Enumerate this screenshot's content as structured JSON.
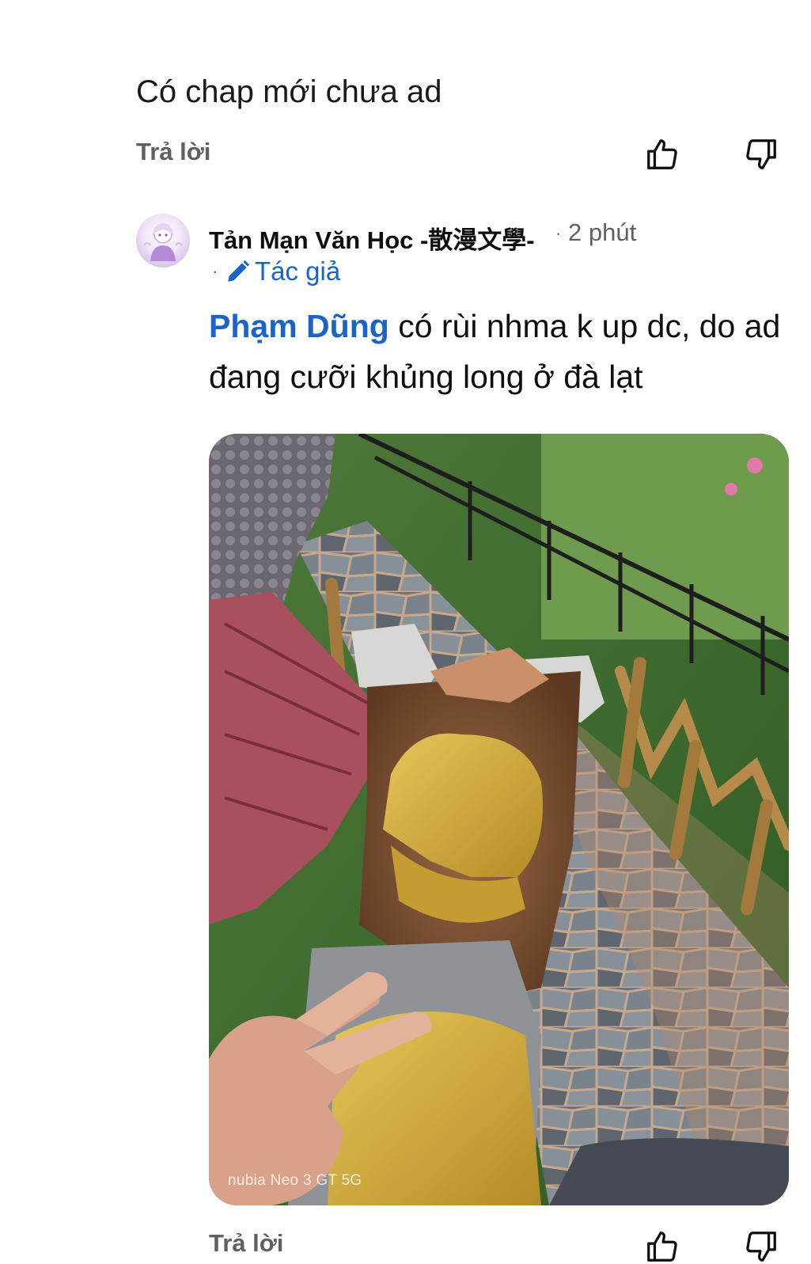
{
  "previous_comment": {
    "text": "Có chap mới chưa ad",
    "reply_label": "Trả lời",
    "like_icon": "thumbs-up-icon",
    "dislike_icon": "thumbs-down-icon"
  },
  "reply": {
    "author": "Tản Mạn Văn Học -散漫文學-",
    "time": "2 phút",
    "author_badge": "Tác giả",
    "badge_icon": "pencil-icon",
    "mention": "Phạm Dũng",
    "text": " có rùi nhma k up dc, do ad đang cưỡi khủng long ở đà lạt",
    "image_watermark": "nubia Neo 3 GT 5G",
    "reply_label": "Trả lời",
    "like_icon": "thumbs-up-icon",
    "dislike_icon": "thumbs-down-icon"
  },
  "colors": {
    "link_blue": "#1a63c9",
    "secondary_text": "#606060",
    "primary_text": "#0f0f0f"
  }
}
